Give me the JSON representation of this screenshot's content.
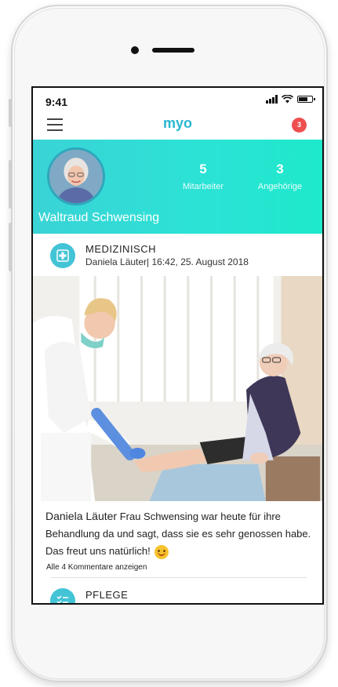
{
  "status_bar": {
    "time": "9:41"
  },
  "app": {
    "logo": "myo",
    "notification_count": "3"
  },
  "profile": {
    "name": "Waltraud Schwensing",
    "stats": [
      {
        "value": "5",
        "label": "Mitarbeiter"
      },
      {
        "value": "3",
        "label": "Angehörige"
      }
    ]
  },
  "post": {
    "category": "MEDIZINISCH",
    "meta": "Daniela Läuter| 16:42, 25. August 2018",
    "author": "Daniela Läuter",
    "text": "Frau Schwensing war heute für ihre Behandlung da und sagt, dass sie es sehr genossen habe. Das freut uns natürlich!",
    "comments_link": "Alle 4 Kommentare anzeigen"
  },
  "next_post": {
    "category": "PFLEGE"
  },
  "icons": {
    "menu": "hamburger-menu-icon",
    "medical": "medical-cross-icon",
    "care": "checklist-icon",
    "emoji": "smiling-face-emoji"
  },
  "colors": {
    "accent": "#2ab7cf",
    "header_gradient_start": "#3ad3d6",
    "header_gradient_end": "#1ee9cb",
    "notification": "#ef4f4f",
    "category_icon": "#43c4d6"
  }
}
